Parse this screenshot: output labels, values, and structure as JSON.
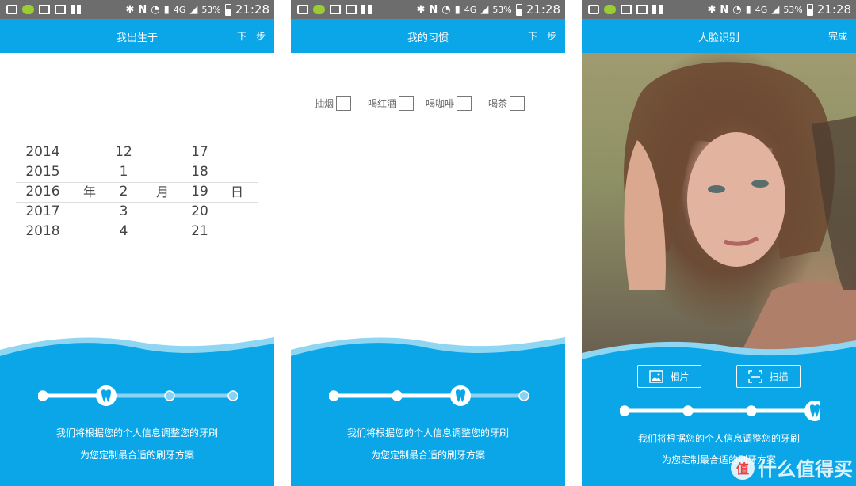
{
  "status_bar": {
    "network": "4G",
    "battery": "53%",
    "time": "21:28",
    "icons": [
      "message-icon",
      "wechat-icon",
      "image-icon",
      "mail-icon",
      "apps-icon",
      "bluetooth-icon",
      "nfc-icon",
      "wifi-icon",
      "sim-icon",
      "signal-icon",
      "battery-icon"
    ]
  },
  "colors": {
    "accent": "#0aa6e8",
    "wave_light": "#8fd6f3",
    "step_active": "#ffffff",
    "step_inactive": "#8bd3f2"
  },
  "screens": [
    {
      "title": "我出生于",
      "action": "下一步",
      "date_picker": {
        "years": [
          "2014",
          "2015",
          "2016",
          "2017",
          "2018"
        ],
        "months": [
          "12",
          "1",
          "2",
          "3",
          "4"
        ],
        "days": [
          "17",
          "18",
          "19",
          "20",
          "21"
        ],
        "year_unit": "年",
        "month_unit": "月",
        "day_unit": "日",
        "selected": {
          "year": "2016",
          "month": "2",
          "day": "19"
        }
      },
      "progress_step": 2,
      "steps_total": 4,
      "info_line1": "我们将根据您的个人信息调整您的牙刷",
      "info_line2": "为您定制最合适的刷牙方案"
    },
    {
      "title": "我的习惯",
      "action": "下一步",
      "habits": [
        {
          "label": "抽烟",
          "checked": false
        },
        {
          "label": "喝红酒",
          "checked": false
        },
        {
          "label": "喝咖啡",
          "checked": false
        },
        {
          "label": "喝茶",
          "checked": false
        }
      ],
      "progress_step": 3,
      "steps_total": 4,
      "info_line1": "我们将根据您的个人信息调整您的牙刷",
      "info_line2": "为您定制最合适的刷牙方案"
    },
    {
      "title": "人脸识别",
      "action": "完成",
      "photo_button": "相片",
      "scan_button": "扫描",
      "progress_step": 4,
      "steps_total": 4,
      "info_line1": "我们将根据您的个人信息调整您的牙刷",
      "info_line2": "为您定制最合适的刷牙方案"
    }
  ],
  "watermark": {
    "badge": "值",
    "text": "什么值得买"
  }
}
